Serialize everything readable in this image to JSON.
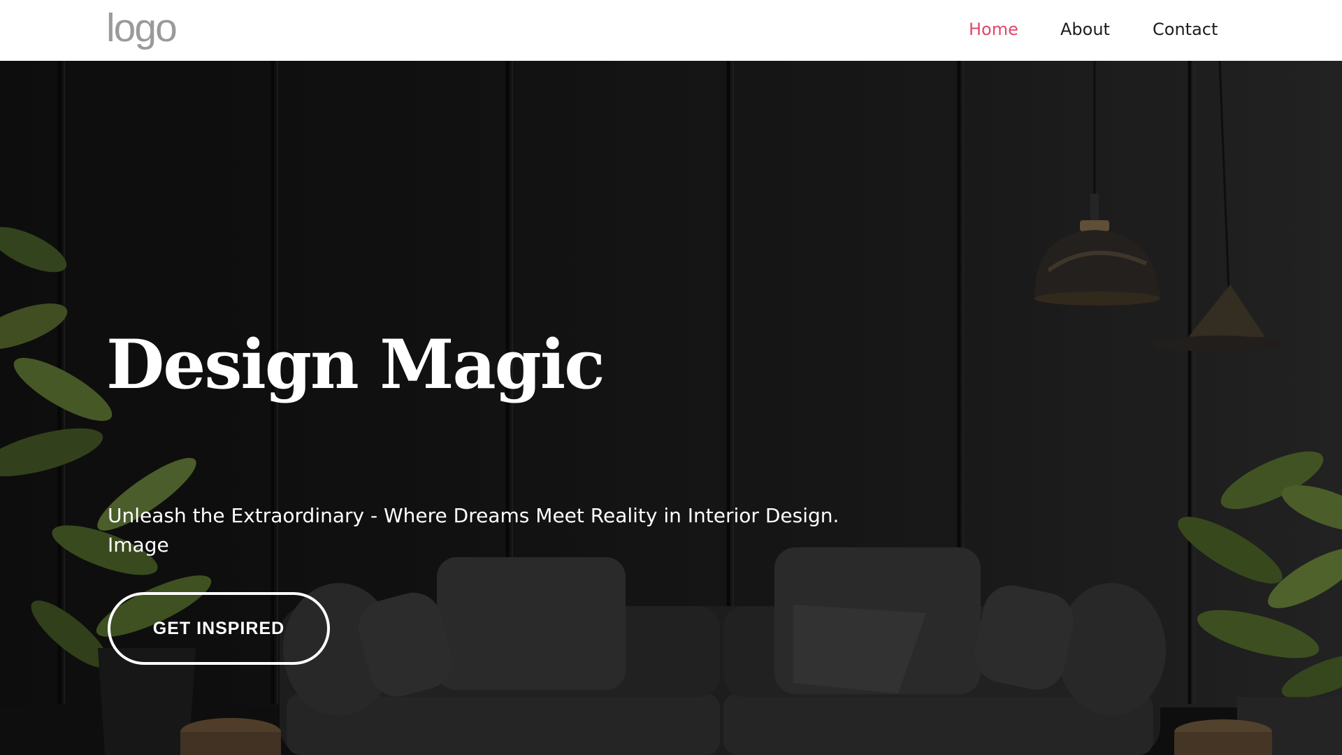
{
  "header": {
    "logo_text": "logo",
    "nav": [
      {
        "label": "Home",
        "active": true
      },
      {
        "label": "About",
        "active": false
      },
      {
        "label": "Contact",
        "active": false
      }
    ]
  },
  "hero": {
    "title": "Design Magic",
    "subtitle": "Unleash the Extraordinary - Where Dreams Meet Reality in Interior Design. Image",
    "cta_label": "GET INSPIRED",
    "background_image": "dark interior with sofa, plants and pendant lamps"
  },
  "colors": {
    "accent": "#e0476a",
    "header_bg": "#ffffff",
    "nav_text": "#1d1d1d",
    "logo": "#9a9a9a",
    "hero_text": "#ffffff"
  }
}
